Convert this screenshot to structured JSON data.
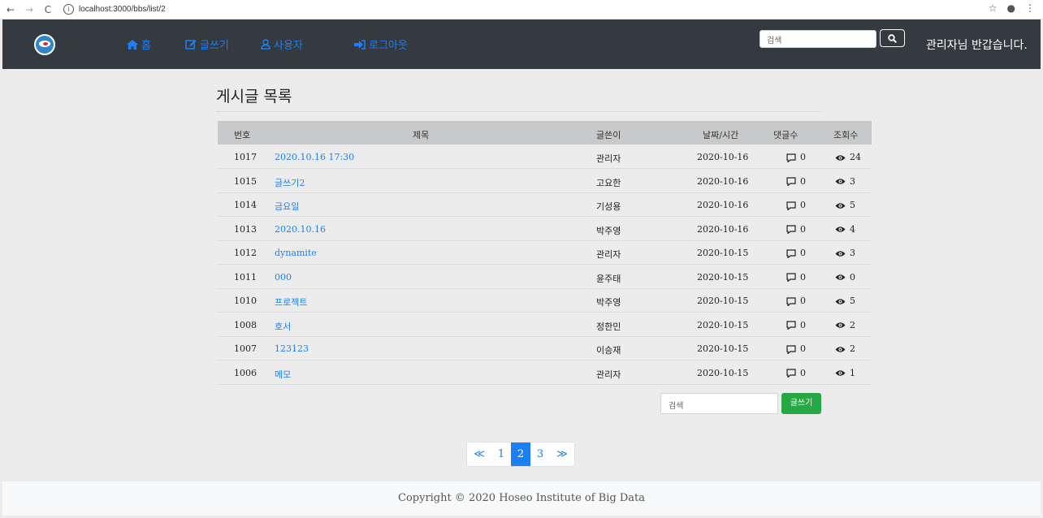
{
  "browser": {
    "url": "localhost:3000/bbs/list/2",
    "back_icon": "←",
    "forward_icon": "→",
    "reload_icon": "C",
    "info_icon": "i"
  },
  "navbar": {
    "home": "홈",
    "write": "글쓰기",
    "users": "사용자",
    "logout": "로그아웃",
    "search_placeholder": "검색",
    "welcome": "관리자님 반갑습니다.",
    "colors": {
      "bg": "#343a40",
      "link": "#1d7ff6"
    }
  },
  "page": {
    "heading": "게시글 목록"
  },
  "table": {
    "headers": [
      "번호",
      "제목",
      "글쓴이",
      "날짜/시간",
      "댓글수",
      "조회수"
    ],
    "rows": [
      {
        "num": "1017",
        "title": "2020.10.16 17:30",
        "author": "관리자",
        "date": "2020-10-16",
        "comments": "0",
        "views": "24"
      },
      {
        "num": "1015",
        "title": "글쓰기2",
        "author": "고요한",
        "date": "2020-10-16",
        "comments": "0",
        "views": "3"
      },
      {
        "num": "1014",
        "title": "금요일",
        "author": "기성용",
        "date": "2020-10-16",
        "comments": "0",
        "views": "5"
      },
      {
        "num": "1013",
        "title": "2020.10.16",
        "author": "박주영",
        "date": "2020-10-16",
        "comments": "0",
        "views": "4"
      },
      {
        "num": "1012",
        "title": "dynamite",
        "author": "관리자",
        "date": "2020-10-15",
        "comments": "0",
        "views": "3"
      },
      {
        "num": "1011",
        "title": "000",
        "author": "윤주태",
        "date": "2020-10-15",
        "comments": "0",
        "views": "0"
      },
      {
        "num": "1010",
        "title": "프로젝트",
        "author": "박주영",
        "date": "2020-10-15",
        "comments": "0",
        "views": "5"
      },
      {
        "num": "1008",
        "title": "호서",
        "author": "정한민",
        "date": "2020-10-15",
        "comments": "0",
        "views": "2"
      },
      {
        "num": "1007",
        "title": "123123",
        "author": "이승재",
        "date": "2020-10-15",
        "comments": "0",
        "views": "2"
      },
      {
        "num": "1006",
        "title": "메모",
        "author": "관리자",
        "date": "2020-10-15",
        "comments": "0",
        "views": "1"
      }
    ]
  },
  "bottom": {
    "search_placeholder": "검색",
    "write_button": "글쓰기"
  },
  "pagination": {
    "prev": "≪",
    "pages": [
      "1",
      "2",
      "3"
    ],
    "current": "2",
    "next": "≫"
  },
  "footer": {
    "text": "Copyright © 2020 Hoseo Institute of Big Data"
  }
}
